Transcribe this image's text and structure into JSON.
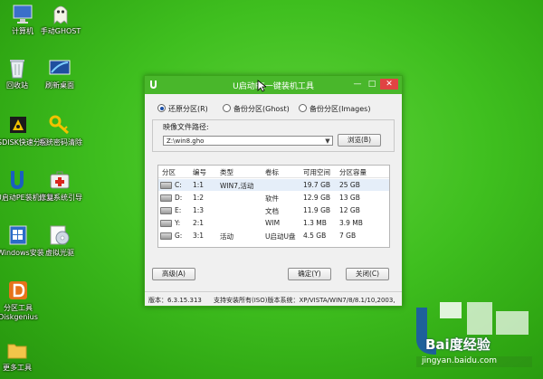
{
  "desktop": {
    "icons": [
      {
        "id": "computer",
        "label": "计算机"
      },
      {
        "id": "ghost",
        "label": "手动GHOST"
      },
      {
        "id": "recycle",
        "label": "回收站"
      },
      {
        "id": "refresh",
        "label": "刷新桌面"
      },
      {
        "id": "disktool",
        "label": "SDISK快速分区"
      },
      {
        "id": "password",
        "label": "系统密码清除"
      },
      {
        "id": "pe-installer",
        "label": "U启动PE装机工具"
      },
      {
        "id": "bootfix",
        "label": "修复系统引导"
      },
      {
        "id": "windows",
        "label": "Windows安装"
      },
      {
        "id": "vdrive",
        "label": "虚拟光驱"
      },
      {
        "id": "diskgenius",
        "label": "分区工具Diskgenius"
      },
      {
        "id": "more",
        "label": "更多工具"
      }
    ]
  },
  "window": {
    "title": "U启动PE一键装机工具",
    "minimize": "—",
    "maximize": "□",
    "close": "✕",
    "radios": [
      {
        "label": "还原分区(R)",
        "checked": true
      },
      {
        "label": "备份分区(Ghost)",
        "checked": false
      },
      {
        "label": "备份分区(Images)",
        "checked": false
      }
    ],
    "image_path_label": "映像文件路径:",
    "image_path_value": "Z:\\win8.gho",
    "browse_button": "浏览(B)",
    "table": {
      "headers": [
        "分区",
        "编号",
        "类型",
        "卷标",
        "可用空间",
        "分区容量"
      ],
      "rows": [
        {
          "part": "C:",
          "num": "1:1",
          "type": "WIN7,活动",
          "label": "",
          "free": "19.7 GB",
          "size": "25 GB",
          "selected": true
        },
        {
          "part": "D:",
          "num": "1:2",
          "type": "",
          "label": "软件",
          "free": "12.9 GB",
          "size": "13 GB",
          "selected": false
        },
        {
          "part": "E:",
          "num": "1:3",
          "type": "",
          "label": "文档",
          "free": "11.9 GB",
          "size": "12 GB",
          "selected": false
        },
        {
          "part": "Y:",
          "num": "2:1",
          "type": "",
          "label": "WIM",
          "free": "1.3 MB",
          "size": "3.9 MB",
          "selected": false
        },
        {
          "part": "G:",
          "num": "3:1",
          "type": "活动",
          "label": "U启动U盘",
          "free": "4.5 GB",
          "size": "7 GB",
          "selected": false
        }
      ]
    },
    "advanced_button": "高级(A)",
    "ok_button": "确定(Y)",
    "close_button": "关闭(C)",
    "status_version": "版本：6.3.15.313",
    "status_support": "支持安装所有(ISO)版本系统：XP/VISTA/WIN7/8/8.1/10,2003,"
  },
  "watermark": {
    "brand": "Bai度经验",
    "url": "jingyan.baidu.com"
  }
}
